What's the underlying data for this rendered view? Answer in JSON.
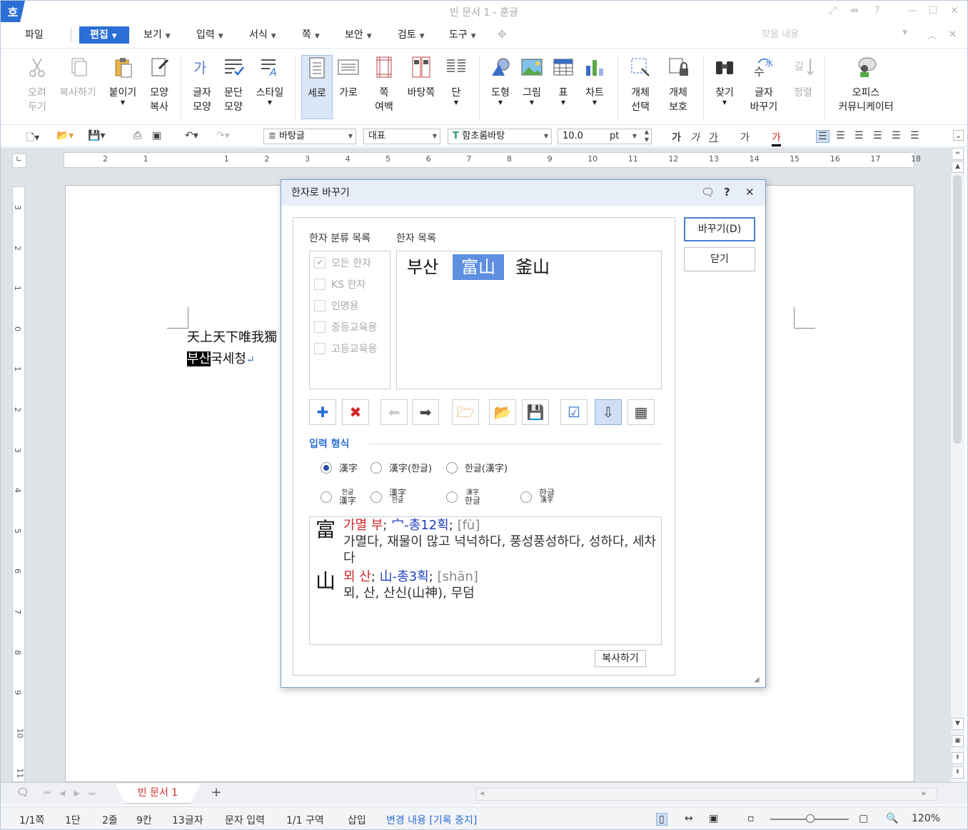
{
  "window": {
    "app_icon": "호",
    "title": "빈 문서 1 - 훈글"
  },
  "menu": {
    "items": [
      {
        "label": "파일"
      },
      {
        "label": "편집"
      },
      {
        "label": "보기"
      },
      {
        "label": "입력"
      },
      {
        "label": "서식"
      },
      {
        "label": "쪽"
      },
      {
        "label": "보안"
      },
      {
        "label": "검토"
      },
      {
        "label": "도구"
      }
    ],
    "search_placeholder": "찾을 내용"
  },
  "ribbon": {
    "cut": "오려\n두기",
    "copy": "복사하기",
    "paste": "붙이기",
    "format_copy": "모양\n복사",
    "char_shape": "글자\n모양",
    "para_shape": "문단\n모양",
    "style": "스타일",
    "vertical": "세로",
    "horizontal": "가로",
    "margin": "쪽\n여백",
    "background": "바탕쪽",
    "column": "단",
    "shape": "도형",
    "picture": "그림",
    "table": "표",
    "chart": "차트",
    "obj_select": "개체\n선택",
    "obj_protect": "개체\n보호",
    "find": "찾기",
    "char_replace": "글자\n바꾸기",
    "sort": "정렬",
    "office_comm": "오피스\n커뮤니케이터"
  },
  "toolbar": {
    "style": "바탕글",
    "outline": "대표",
    "font": "함초롬바탕",
    "size": "10.0",
    "unit": "pt",
    "format_buttons": [
      "가",
      "가",
      "가",
      "가",
      "가"
    ]
  },
  "ruler": {
    "h": [
      "2",
      "1",
      "",
      "1",
      "2",
      "3",
      "4",
      "5",
      "6",
      "7",
      "8",
      "9",
      "10",
      "11",
      "12",
      "13",
      "14",
      "15",
      "16",
      "17",
      "18"
    ],
    "v": [
      "3",
      "2",
      "1",
      "0",
      "1",
      "2",
      "3",
      "4",
      "5",
      "6",
      "7",
      "8",
      "9",
      "10",
      "11"
    ]
  },
  "document": {
    "line1": "天上天下唯我獨",
    "line2_selected": "부산",
    "line2_rest": "국세청",
    "para_mark": "↵"
  },
  "tabs": {
    "doc_tab": "빈 문서 1",
    "add": "+"
  },
  "status": {
    "page": "1/1쪽",
    "col": "1단",
    "line": "2줄",
    "pos": "9칸",
    "chars": "13글자",
    "mode": "문자 입력",
    "section": "1/1 구역",
    "insert": "삽입",
    "track": "변경 내용 [기록 중지]",
    "zoom": "120%"
  },
  "dialog": {
    "title": "한자로 바꾸기",
    "category_header": "한자 분류 목록",
    "list_header": "한자 목록",
    "categories": [
      {
        "label": "모든 한자",
        "checked": true
      },
      {
        "label": "KS 한자",
        "checked": false
      },
      {
        "label": "인명용",
        "checked": false
      },
      {
        "label": "중등교육용",
        "checked": false
      },
      {
        "label": "고등교육용",
        "checked": false
      }
    ],
    "candidates": [
      "부산",
      "富山",
      "釜山"
    ],
    "input_format_label": "입력 형식",
    "formats": {
      "f1": "漢字",
      "f2": "漢字(한글)",
      "f3": "한글(漢字)",
      "f4_top": "한글",
      "f4_bot": "漢字",
      "f5_top": "漢字",
      "f5_bot": "한글",
      "f6_top": "漢字",
      "f6_bot": "한글",
      "f7_top": "한글",
      "f7_bot": "漢字"
    },
    "meaning": {
      "c1": "富",
      "c1_read": "가멸 부",
      "c1_radical": "宀-총12획",
      "c1_pinyin": "[fù]",
      "c1_def": "가멸다, 재물이 많고 넉넉하다, 풍성풍성하다, 성하다, 세차다",
      "c2": "山",
      "c2_read": "뫼 산",
      "c2_radical": "山-총3획",
      "c2_pinyin": "[shān]",
      "c2_def": "뫼, 산, 산신(山神), 무덤"
    },
    "copy": "복사하기",
    "replace": "바꾸기(D)",
    "close": "닫기",
    "sep": ";"
  }
}
